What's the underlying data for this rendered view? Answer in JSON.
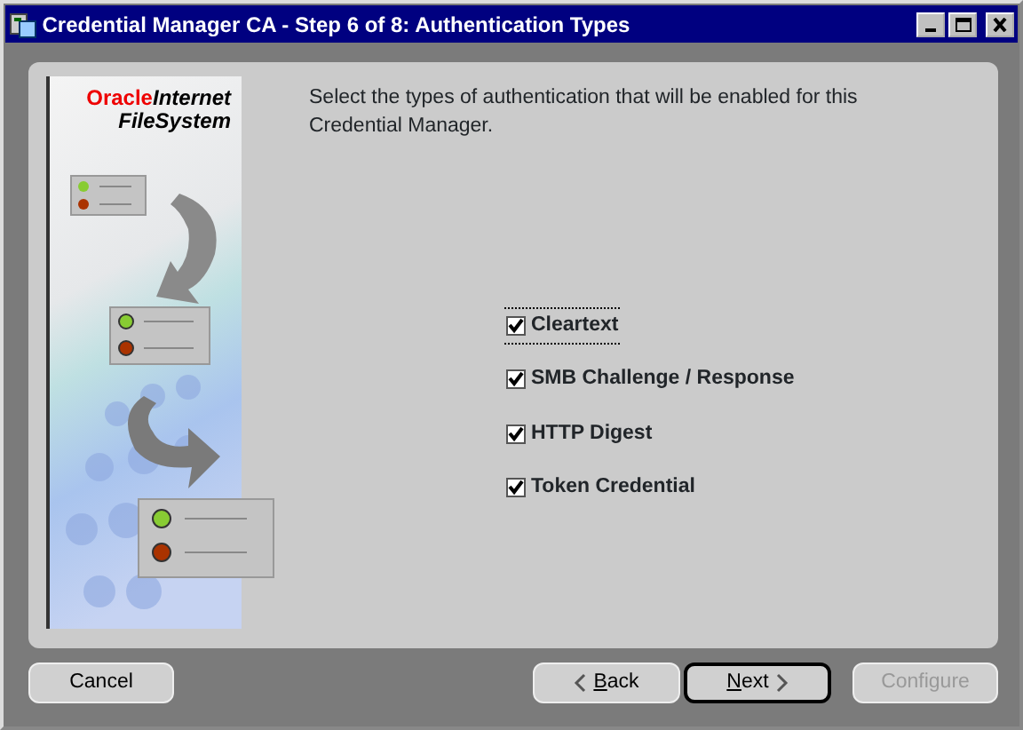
{
  "window": {
    "title": "Credential Manager CA - Step 6 of 8: Authentication Types"
  },
  "logo": {
    "brand": "Oracle",
    "product": "Internet",
    "line2": "FileSystem"
  },
  "instruction": "Select the types of authentication that will be enabled for this Credential Manager.",
  "options": [
    {
      "label": "Cleartext",
      "checked": true,
      "focused": true
    },
    {
      "label": "SMB Challenge / Response",
      "checked": true,
      "focused": false
    },
    {
      "label": "HTTP Digest",
      "checked": true,
      "focused": false
    },
    {
      "label": "Token Credential",
      "checked": true,
      "focused": false
    }
  ],
  "buttons": [
    {
      "label": "Cancel",
      "kind": "cancel",
      "disabled": false,
      "default": false
    },
    {
      "label": "Back",
      "kind": "back",
      "mnemonic": true,
      "disabled": false,
      "default": false
    },
    {
      "label": "Next",
      "kind": "next",
      "mnemonic": true,
      "disabled": false,
      "default": true
    },
    {
      "label": "Configure",
      "kind": "configure",
      "disabled": true,
      "default": false
    }
  ]
}
